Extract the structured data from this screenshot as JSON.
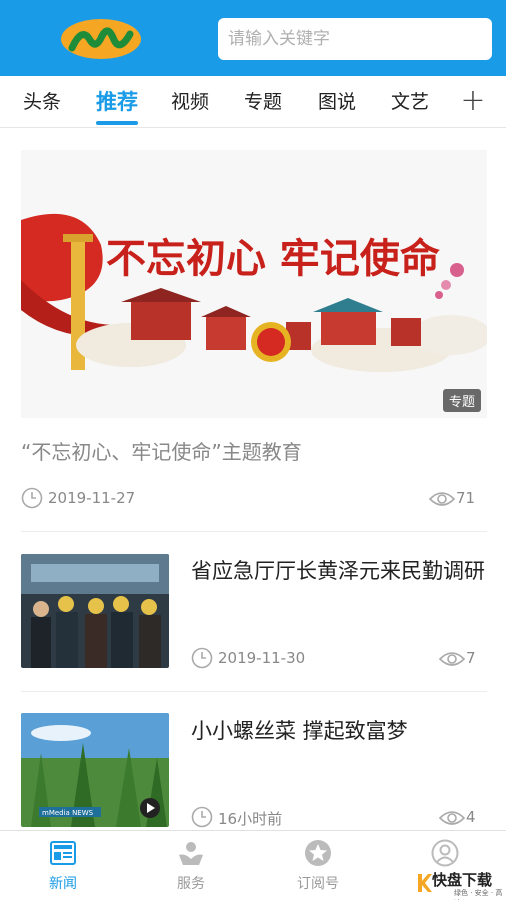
{
  "header": {
    "search_placeholder": "请输入关键字"
  },
  "tabs": [
    {
      "label": "头条"
    },
    {
      "label": "推荐"
    },
    {
      "label": "视频"
    },
    {
      "label": "专题"
    },
    {
      "label": "图说"
    },
    {
      "label": "文艺"
    }
  ],
  "active_tab": "推荐",
  "feature": {
    "banner_text": "不忘初心 牢记使命",
    "badge": "专题",
    "title": "“不忘初心、牢记使命”主题教育",
    "date": "2019-11-27",
    "views": "71"
  },
  "news": [
    {
      "title": "省应急厅厅长黄泽元来民勤调研",
      "date": "2019-11-30",
      "views": "7"
    },
    {
      "title": "小小螺丝菜  撑起致富梦",
      "date": "16小时前",
      "views": "4",
      "video_caption": "mMedia NEWS"
    }
  ],
  "bottom_nav": [
    {
      "label": "新闻",
      "icon": "news-icon"
    },
    {
      "label": "服务",
      "icon": "service-icon"
    },
    {
      "label": "订阅号",
      "icon": "subscription-icon"
    },
    {
      "label": "",
      "icon": "user-icon"
    }
  ],
  "watermark": {
    "brand": "快盘下载",
    "sub": "绿色 · 安全 · 高速"
  },
  "colors": {
    "accent": "#1a9be8",
    "party_red": "#d42a22"
  }
}
